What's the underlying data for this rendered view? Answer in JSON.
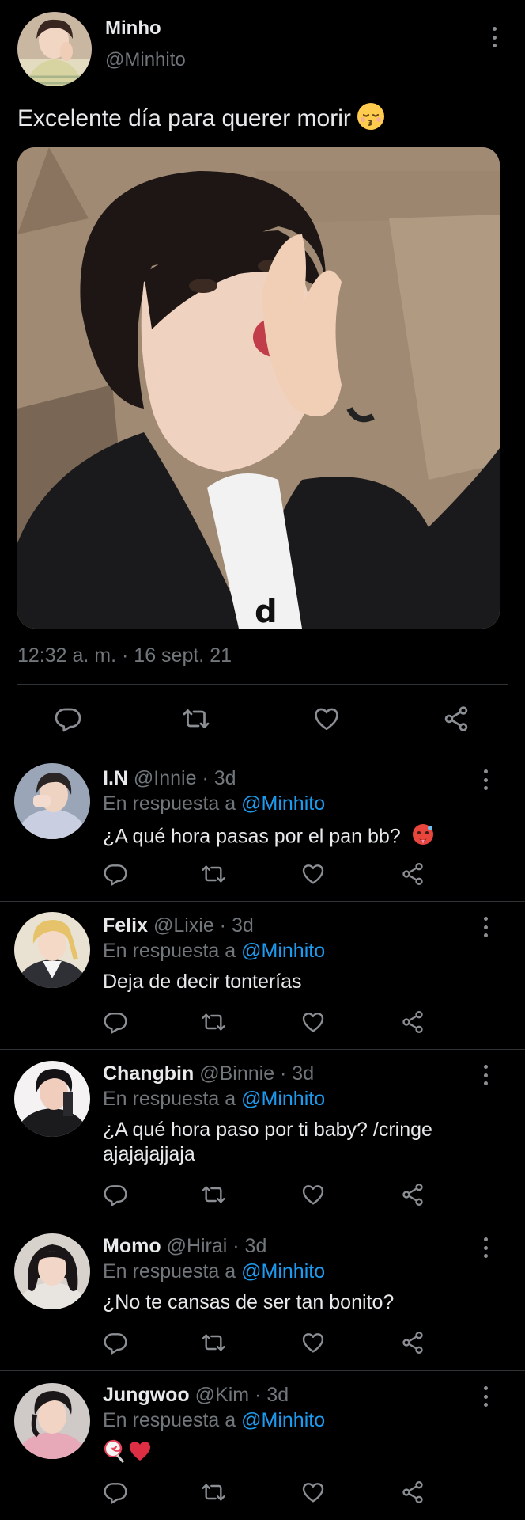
{
  "tweet": {
    "name": "Minho",
    "handle": "@Minhito",
    "text": "Excelente día para querer morir",
    "text_emoji": "kissing-face-closed-eyes",
    "timestamp": "12:32 a. m. · 16 sept. 21"
  },
  "replies": [
    {
      "name": "I.N",
      "meta": "@Innie · 3d",
      "replying_prefix": "En respuesta a",
      "mention": "@Minhito",
      "text": "¿A qué hora pasas por el pan bb?",
      "emoji": "hot-face"
    },
    {
      "name": "Felix",
      "meta": "@Lixie · 3d",
      "replying_prefix": "En respuesta a",
      "mention": "@Minhito",
      "text": "Deja de decir tonterías"
    },
    {
      "name": "Changbin",
      "meta": "@Binnie · 3d",
      "replying_prefix": "En respuesta a",
      "mention": "@Minhito",
      "text": "¿A qué hora paso por ti baby? /cringe ajajajajjaja"
    },
    {
      "name": "Momo",
      "meta": "@Hirai · 3d",
      "replying_prefix": "En respuesta a",
      "mention": "@Minhito",
      "text": "¿No te cansas de ser tan bonito?"
    },
    {
      "name": "Jungwoo",
      "meta": "@Kim · 3d",
      "replying_prefix": "En respuesta a",
      "mention": "@Minhito",
      "text": "",
      "emoji": "lollipop + red-heart"
    }
  ],
  "colors": {
    "background": "#000000",
    "text": "#e7e9ea",
    "secondary": "#71767b",
    "link": "#1d9bf0",
    "divider": "#2f3336"
  }
}
